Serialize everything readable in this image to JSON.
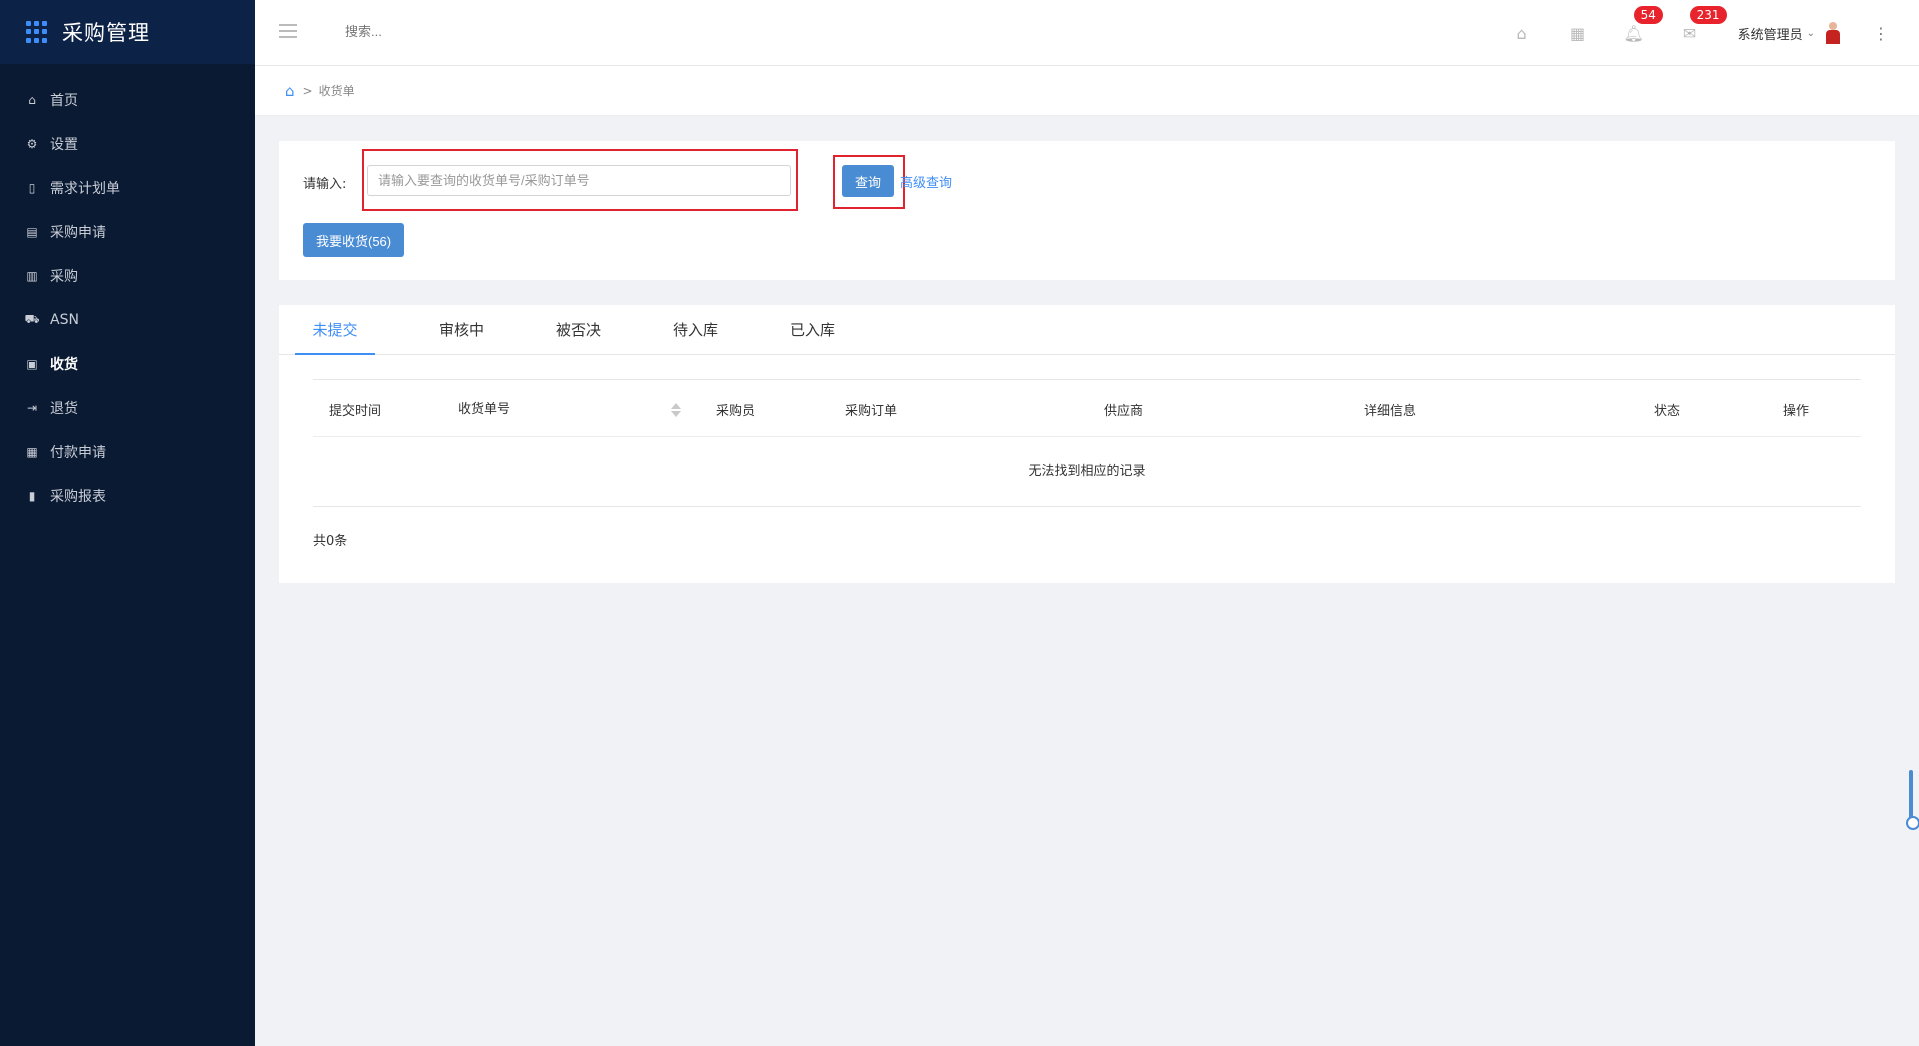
{
  "app": {
    "title": "采购管理",
    "logo_icon": "grid-icon",
    "accent": "#3e8ef7",
    "sidebar_bg": "#0b1a33"
  },
  "sidebar": {
    "items": [
      {
        "label": "首页",
        "icon": "home-icon"
      },
      {
        "label": "设置",
        "icon": "gear-icon"
      },
      {
        "label": "需求计划单",
        "icon": "document-icon"
      },
      {
        "label": "采购申请",
        "icon": "form-icon"
      },
      {
        "label": "采购",
        "icon": "list-icon"
      },
      {
        "label": "ASN",
        "icon": "truck-icon"
      },
      {
        "label": "收货",
        "icon": "inbox-icon",
        "active": true
      },
      {
        "label": "退货",
        "icon": "exit-icon"
      },
      {
        "label": "付款申请",
        "icon": "payment-icon"
      },
      {
        "label": "采购报表",
        "icon": "chart-icon"
      }
    ]
  },
  "topbar": {
    "search_placeholder": "搜索...",
    "notifications_badge": "54",
    "messages_badge": "231",
    "user_name": "系统管理员"
  },
  "breadcrumb": {
    "separator": ">",
    "current": "收货单"
  },
  "search_form": {
    "label": "请输入:",
    "input_placeholder": "请输入要查询的收货单号/采购订单号",
    "input_value": "",
    "query_button": "查询",
    "advanced_link": "高级查询",
    "receive_button": "我要收货(56)"
  },
  "tabs": [
    {
      "label": "未提交",
      "active": true
    },
    {
      "label": "审核中"
    },
    {
      "label": "被否决"
    },
    {
      "label": "待入库"
    },
    {
      "label": "已入库"
    }
  ],
  "table": {
    "columns": [
      "提交时间",
      "收货单号",
      "采购员",
      "采购订单",
      "供应商",
      "详细信息",
      "状态",
      "操作"
    ],
    "empty_text": "无法找到相应的记录",
    "total_text": "共0条"
  }
}
